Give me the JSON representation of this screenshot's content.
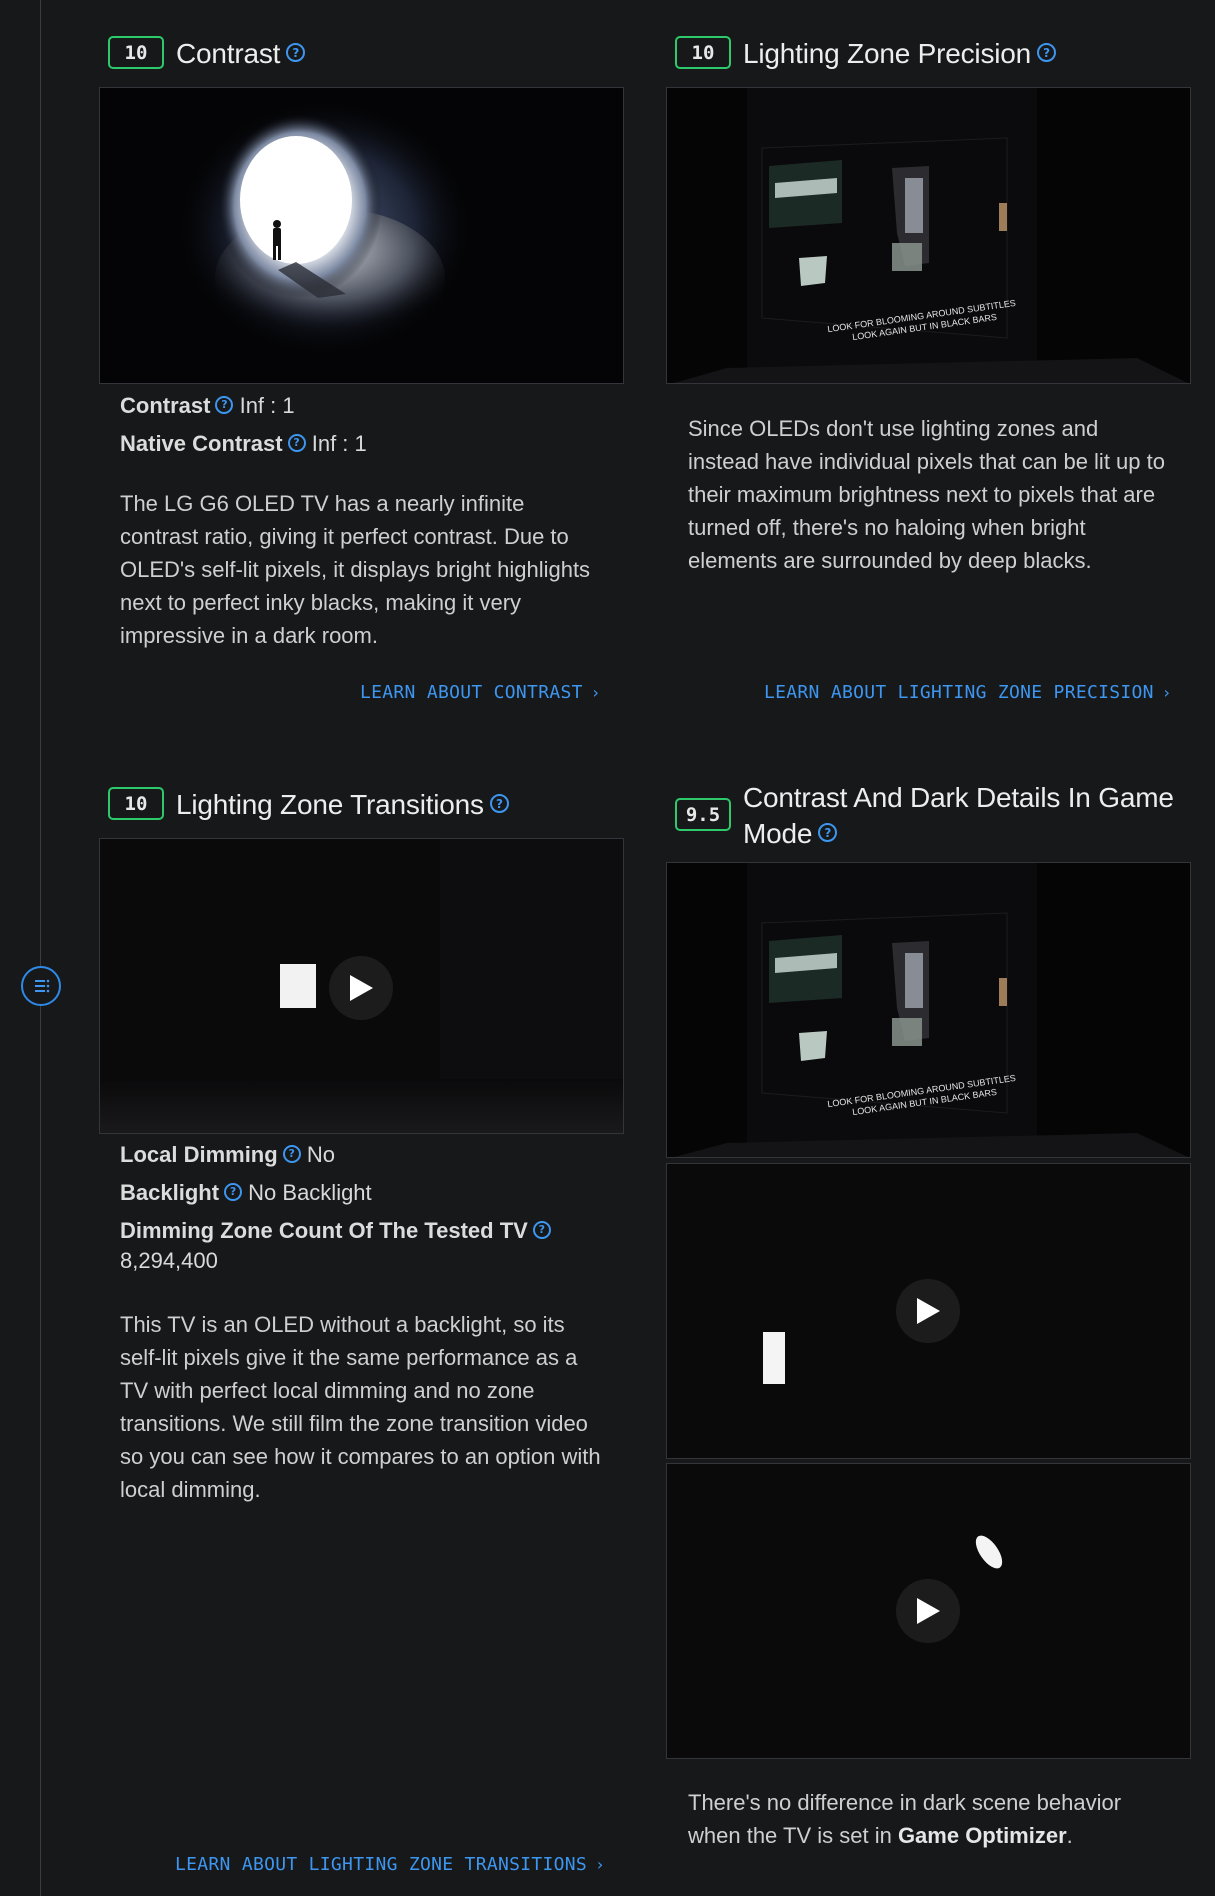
{
  "sections": {
    "contrast": {
      "score": "10",
      "title": "Contrast",
      "specs": [
        {
          "label": "Contrast",
          "value": "Inf : 1"
        },
        {
          "label": "Native Contrast",
          "value": "Inf : 1"
        }
      ],
      "description": "The LG G6 OLED TV has a nearly infinite contrast ratio, giving it perfect contrast. Due to OLED's self-lit pixels, it displays bright highlights next to perfect inky blacks, making it very impressive in a dark room.",
      "link": "LEARN ABOUT CONTRAST"
    },
    "lighting_zone_precision": {
      "score": "10",
      "title": "Lighting Zone Precision",
      "image_caption_line1": "LOOK FOR BLOOMING AROUND SUBTITLES",
      "image_caption_line2": "LOOK AGAIN BUT IN BLACK BARS",
      "description": "Since OLEDs don't use lighting zones and instead have individual pixels that can be lit up to their maximum brightness next to pixels that are turned off, there's no haloing when bright elements are surrounded by deep blacks.",
      "link": "LEARN ABOUT LIGHTING ZONE PRECISION"
    },
    "lighting_zone_transitions": {
      "score": "10",
      "title": "Lighting Zone Transitions",
      "specs": [
        {
          "label": "Local Dimming",
          "value": "No"
        },
        {
          "label": "Backlight",
          "value": "No Backlight"
        },
        {
          "label": "Dimming Zone Count Of The Tested TV",
          "value": "8,294,400"
        }
      ],
      "description": "This TV is an OLED without a backlight, so its self-lit pixels give it the same performance as a TV with perfect local dimming and no zone transitions. We still film the zone transition video so you can see how it compares to an option with local dimming.",
      "link": "LEARN ABOUT LIGHTING ZONE TRANSITIONS"
    },
    "game_mode": {
      "score": "9.5",
      "title": "Contrast And Dark Details In Game Mode",
      "image_caption_line1": "LOOK FOR BLOOMING AROUND SUBTITLES",
      "image_caption_line2": "LOOK AGAIN BUT IN BLACK BARS",
      "description_prefix": "There's no difference in dark scene behavior when the TV is set in ",
      "description_bold": "Game Optimizer",
      "description_suffix": "."
    }
  },
  "icons": {
    "help": "question-circle-icon",
    "toc": "table-of-contents-icon",
    "play": "play-icon",
    "chevron": "chevron-right-icon"
  },
  "colors": {
    "background": "#17181a",
    "score_border": "#2ec96a",
    "link": "#3d96ef"
  }
}
